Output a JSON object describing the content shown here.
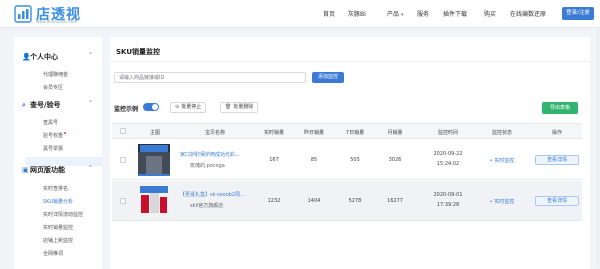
{
  "brand": {
    "name": "店透视",
    "url": "www.diantoushi.com"
  },
  "nav": {
    "items": [
      "首页",
      "灰豚BI",
      "产品",
      "服务",
      "插件下载",
      "购买",
      "在线编数还原"
    ],
    "login_label": "登录/注册"
  },
  "sidebar": {
    "groups": [
      {
        "title": "个人中心",
        "icon": "user-icon",
        "items": [
          "代理赚佣金",
          "会员专区"
        ]
      },
      {
        "title": "查号/验号",
        "icon": "search-icon",
        "items": [
          "查黑号",
          "验号权重",
          "黑号举报"
        ]
      },
      {
        "title": "网页版功能",
        "icon": "monitor-icon",
        "items": [
          "实时查排名",
          "SKU销量分析",
          "实时详情流动监控",
          "实时销量监控",
          "店铺上新监控",
          "全网推词"
        ]
      }
    ],
    "active_item": "SKU销量分析"
  },
  "page": {
    "title": "SKU销量监控",
    "search_placeholder": "请输入商品链接或ID",
    "add_label": "添加监控",
    "monitor_label": "监控示例",
    "bulk_stop_label": "批量停止",
    "bulk_delete_label": "批量删除",
    "export_label": "导出表格"
  },
  "table": {
    "headers": [
      "主图",
      "宝贝名称",
      "实时销量",
      "昨日销量",
      "7日销量",
      "月销量",
      "监控时间",
      "监控状态",
      "操作"
    ],
    "rows": [
      {
        "title": "家口护肘保护用成功光彩...",
        "shop": "玫瑰的,pocoga",
        "realtime": "167",
        "yesterday": "85",
        "week": "505",
        "month": "3026",
        "date": "2020-09-22",
        "time": "15:24:02",
        "status": "实时监控",
        "action": "查看详情",
        "thumb_label": "监控示例"
      },
      {
        "title": "【圣诞礼盒】sk-ssoob2周...",
        "shop": "skii官方旗舰店",
        "realtime": "1232",
        "yesterday": "1404",
        "week": "5278",
        "month": "16277",
        "date": "2020-09-01",
        "time": "17:39:28",
        "status": "实时监控",
        "action": "查看详情",
        "thumb_label": "监控示例"
      }
    ]
  },
  "colors": {
    "accent": "#3a7bd5",
    "export": "#32b36e",
    "brand": "#3a8ee6"
  }
}
